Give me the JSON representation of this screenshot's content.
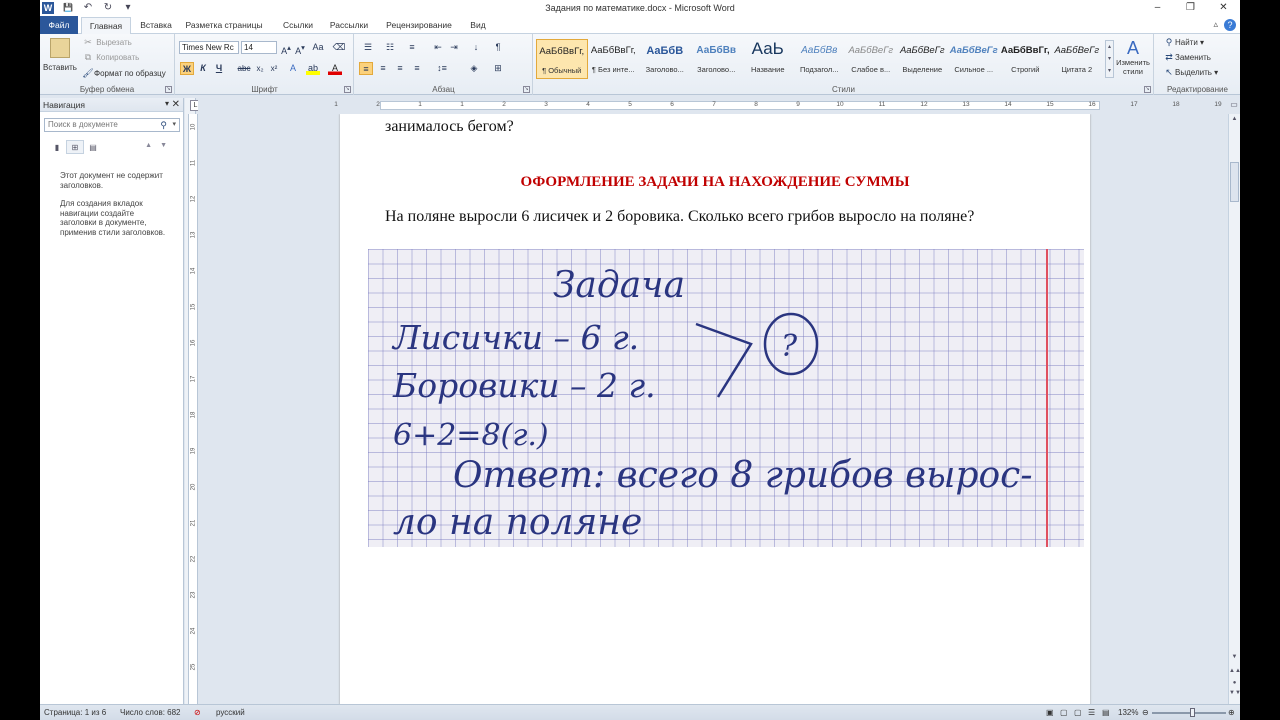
{
  "window": {
    "title": "Задания по математике.docx - Microsoft Word",
    "logo": "W",
    "controls": {
      "minimize": "–",
      "restore": "❐",
      "close": "✕"
    }
  },
  "qat": {
    "save": "💾",
    "undo": "↶",
    "redo": "↻",
    "customize": "▾"
  },
  "tabs": [
    "Файл",
    "Главная",
    "Вставка",
    "Разметка страницы",
    "Ссылки",
    "Рассылки",
    "Рецензирование",
    "Вид"
  ],
  "help": "?",
  "ribbon": {
    "clipboard": {
      "paste": "Вставить",
      "cut": "Вырезать",
      "copy": "Копировать",
      "format_painter": "Формат по образцу",
      "label": "Буфер обмена"
    },
    "font": {
      "font_name": "Times New Rc",
      "font_size": "14",
      "label": "Шрифт",
      "buttons": [
        "Ж",
        "К",
        "Ч",
        "abc",
        "x₂",
        "x²",
        "Aa"
      ]
    },
    "paragraph": {
      "label": "Абзац"
    },
    "styles": {
      "label": "Стили",
      "items": [
        {
          "preview": "АаБбВвГг,",
          "name": "¶ Обычный"
        },
        {
          "preview": "АаБбВвГг,",
          "name": "¶ Без инте..."
        },
        {
          "preview": "АаБбВ",
          "name": "Заголово..."
        },
        {
          "preview": "АаБбВв",
          "name": "Заголово..."
        },
        {
          "preview": "АаЬ",
          "name": "Название"
        },
        {
          "preview": "АаБбВв",
          "name": "Подзагол..."
        },
        {
          "preview": "АаБбВеГг",
          "name": "Слабое в..."
        },
        {
          "preview": "АаБбВеГг",
          "name": "Выделение"
        },
        {
          "preview": "АаБбВеГг",
          "name": "Сильное ..."
        },
        {
          "preview": "АаБбВвГг,",
          "name": "Строгий"
        },
        {
          "preview": "АаБбВеГг",
          "name": "Цитата 2"
        }
      ],
      "change_styles": "Изменить стили"
    },
    "editing": {
      "label": "Редактирование",
      "find": "Найти",
      "replace": "Заменить",
      "select": "Выделить"
    }
  },
  "nav": {
    "title": "Навигация",
    "search_placeholder": "Поиск в документе",
    "msg1": "Этот документ не содержит заголовков.",
    "msg2": "Для создания вкладок навигации создайте заголовки в документе, применив стили заголовков."
  },
  "ruler": {
    "h_numbers": [
      "1",
      "2",
      "1",
      "1",
      "2",
      "3",
      "4",
      "5",
      "6",
      "7",
      "8",
      "9",
      "10",
      "11",
      "12",
      "13",
      "14",
      "15",
      "16",
      "17",
      "18",
      "19"
    ],
    "v_numbers": [
      "10",
      "11",
      "12",
      "13",
      "14",
      "15",
      "16",
      "17",
      "18",
      "19",
      "20",
      "21",
      "22",
      "23",
      "24",
      "25"
    ]
  },
  "document": {
    "line1": "занималось бегом?",
    "heading": "ОФОРМЛЕНИЕ ЗАДАЧИ НА НАХОЖДЕНИЕ  СУММЫ",
    "line2": "На поляне выросли 6 лисичек и 2 боровика. Сколько всего грибов выросло на поляне?",
    "notebook": {
      "title": "Задача",
      "row1": "Лисички – 6 г.",
      "row2": "Боровики – 2 г.",
      "question": "?",
      "equation": "6+2=8(г.)",
      "answer1": "Ответ: всего 8 грибов вырос-",
      "answer2": "ло на поляне"
    }
  },
  "status": {
    "page": "Страница: 1 из 6",
    "words": "Число слов: 682",
    "lang": "русский",
    "zoom": "132%"
  }
}
